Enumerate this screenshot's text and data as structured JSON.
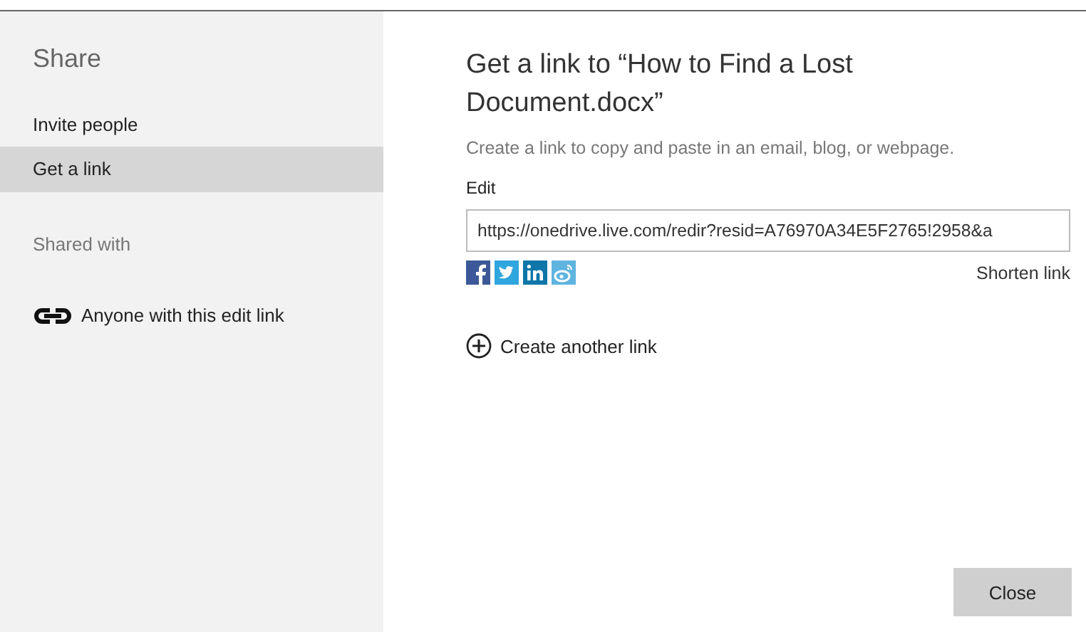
{
  "sidebar": {
    "title": "Share",
    "items": [
      {
        "label": "Invite people",
        "selected": false
      },
      {
        "label": "Get a link",
        "selected": true
      }
    ],
    "shared_with": {
      "heading": "Shared with",
      "entries": [
        {
          "label": "Anyone with this edit link"
        }
      ]
    }
  },
  "main": {
    "title": "Get a link to “How to Find a Lost Document.docx”",
    "description": "Create a link to copy and paste in an email, blog, or webpage.",
    "permission": "Edit",
    "link": {
      "value": "https://onedrive.live.com/redir?resid=A76970A34E5F2765!2958&a"
    },
    "shorten": "Shorten link",
    "create_another": "Create another link"
  },
  "buttons": [
    {
      "label": "Close"
    }
  ]
}
